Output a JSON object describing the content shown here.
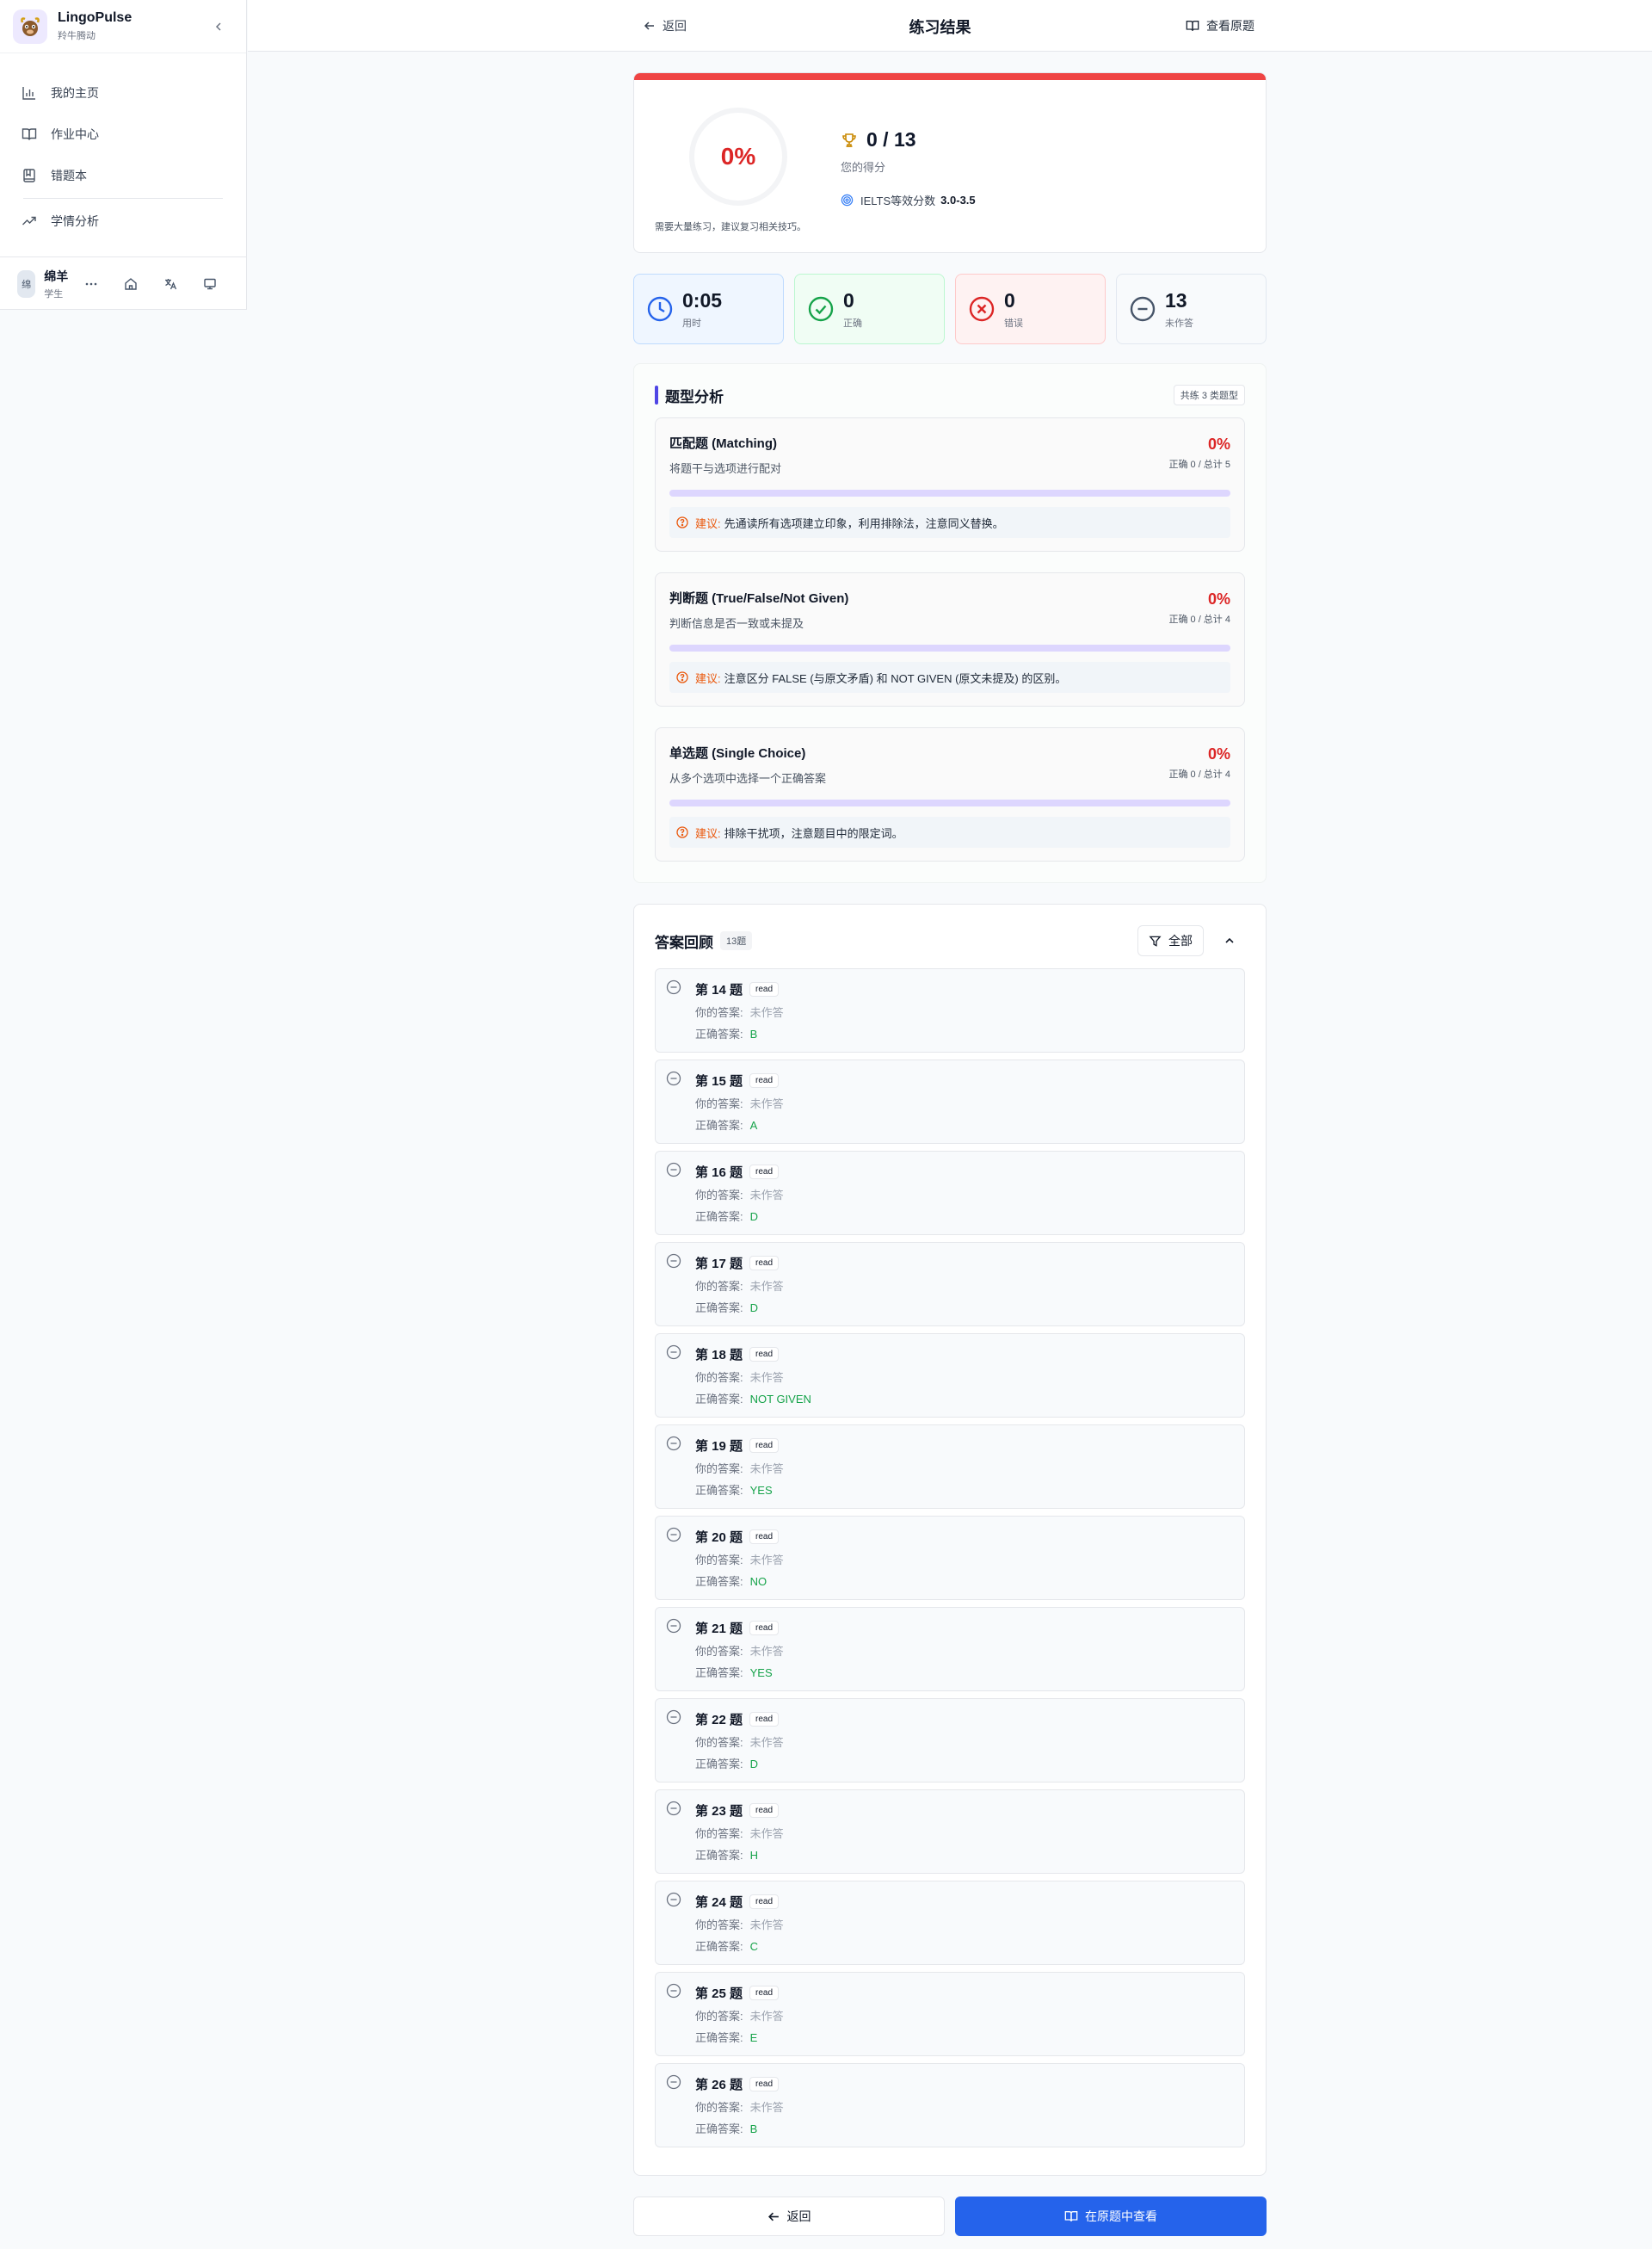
{
  "sidebar": {
    "brand_name": "LingoPulse",
    "brand_sub": "羚牛腾动",
    "items": [
      {
        "label": "我的主页",
        "icon": "bar-chart-icon"
      },
      {
        "label": "作业中心",
        "icon": "book-open-icon"
      },
      {
        "label": "错题本",
        "icon": "notebook-icon"
      },
      {
        "label": "学情分析",
        "icon": "trending-up-icon"
      }
    ],
    "user": {
      "avatar": "绵",
      "name": "绵羊",
      "role": "学生"
    }
  },
  "header": {
    "back": "返回",
    "title": "练习结果",
    "view_original": "查看原题"
  },
  "score": {
    "percent": "0%",
    "hint": "需要大量练习，建议复习相关技巧。",
    "value": "0 / 13",
    "label": "您的得分",
    "ielts_label": "IELTS等效分数",
    "ielts_value": "3.0-3.5",
    "accent": "#ef4444"
  },
  "stats": [
    {
      "value": "0:05",
      "label": "用时",
      "icon": "clock-icon"
    },
    {
      "value": "0",
      "label": "正确",
      "icon": "check-circle-icon"
    },
    {
      "value": "0",
      "label": "错误",
      "icon": "x-circle-icon"
    },
    {
      "value": "13",
      "label": "未作答",
      "icon": "minus-circle-icon"
    }
  ],
  "analysis": {
    "title": "题型分析",
    "badge": "共练 3 类题型",
    "tip_label": "建议:",
    "types": [
      {
        "name": "匹配题 (Matching)",
        "desc": "将题干与选项进行配对",
        "percent": "0%",
        "count": "正确 0 / 总计 5",
        "tip": "先通读所有选项建立印象，利用排除法，注意同义替换。"
      },
      {
        "name": "判断题 (True/False/Not Given)",
        "desc": "判断信息是否一致或未提及",
        "percent": "0%",
        "count": "正确 0 / 总计 4",
        "tip": "注意区分 FALSE (与原文矛盾) 和 NOT GIVEN (原文未提及) 的区别。"
      },
      {
        "name": "单选题 (Single Choice)",
        "desc": "从多个选项中选择一个正确答案",
        "percent": "0%",
        "count": "正确 0 / 总计 4",
        "tip": "排除干扰项，注意题目中的限定词。"
      }
    ]
  },
  "review": {
    "title": "答案回顾",
    "count": "13题",
    "filter": "全部",
    "your_label": "你的答案:",
    "correct_label": "正确答案:",
    "questions": [
      {
        "no": "第 14 题",
        "tag": "read",
        "yours": "未作答",
        "correct": "B"
      },
      {
        "no": "第 15 题",
        "tag": "read",
        "yours": "未作答",
        "correct": "A"
      },
      {
        "no": "第 16 题",
        "tag": "read",
        "yours": "未作答",
        "correct": "D"
      },
      {
        "no": "第 17 题",
        "tag": "read",
        "yours": "未作答",
        "correct": "D"
      },
      {
        "no": "第 18 题",
        "tag": "read",
        "yours": "未作答",
        "correct": "NOT GIVEN"
      },
      {
        "no": "第 19 题",
        "tag": "read",
        "yours": "未作答",
        "correct": "YES"
      },
      {
        "no": "第 20 题",
        "tag": "read",
        "yours": "未作答",
        "correct": "NO"
      },
      {
        "no": "第 21 题",
        "tag": "read",
        "yours": "未作答",
        "correct": "YES"
      },
      {
        "no": "第 22 题",
        "tag": "read",
        "yours": "未作答",
        "correct": "D"
      },
      {
        "no": "第 23 题",
        "tag": "read",
        "yours": "未作答",
        "correct": "H"
      },
      {
        "no": "第 24 题",
        "tag": "read",
        "yours": "未作答",
        "correct": "C"
      },
      {
        "no": "第 25 题",
        "tag": "read",
        "yours": "未作答",
        "correct": "E"
      },
      {
        "no": "第 26 题",
        "tag": "read",
        "yours": "未作答",
        "correct": "B"
      }
    ]
  },
  "footer": {
    "back": "返回",
    "view_in_original": "在原题中查看",
    "primary_color": "#2563eb"
  }
}
